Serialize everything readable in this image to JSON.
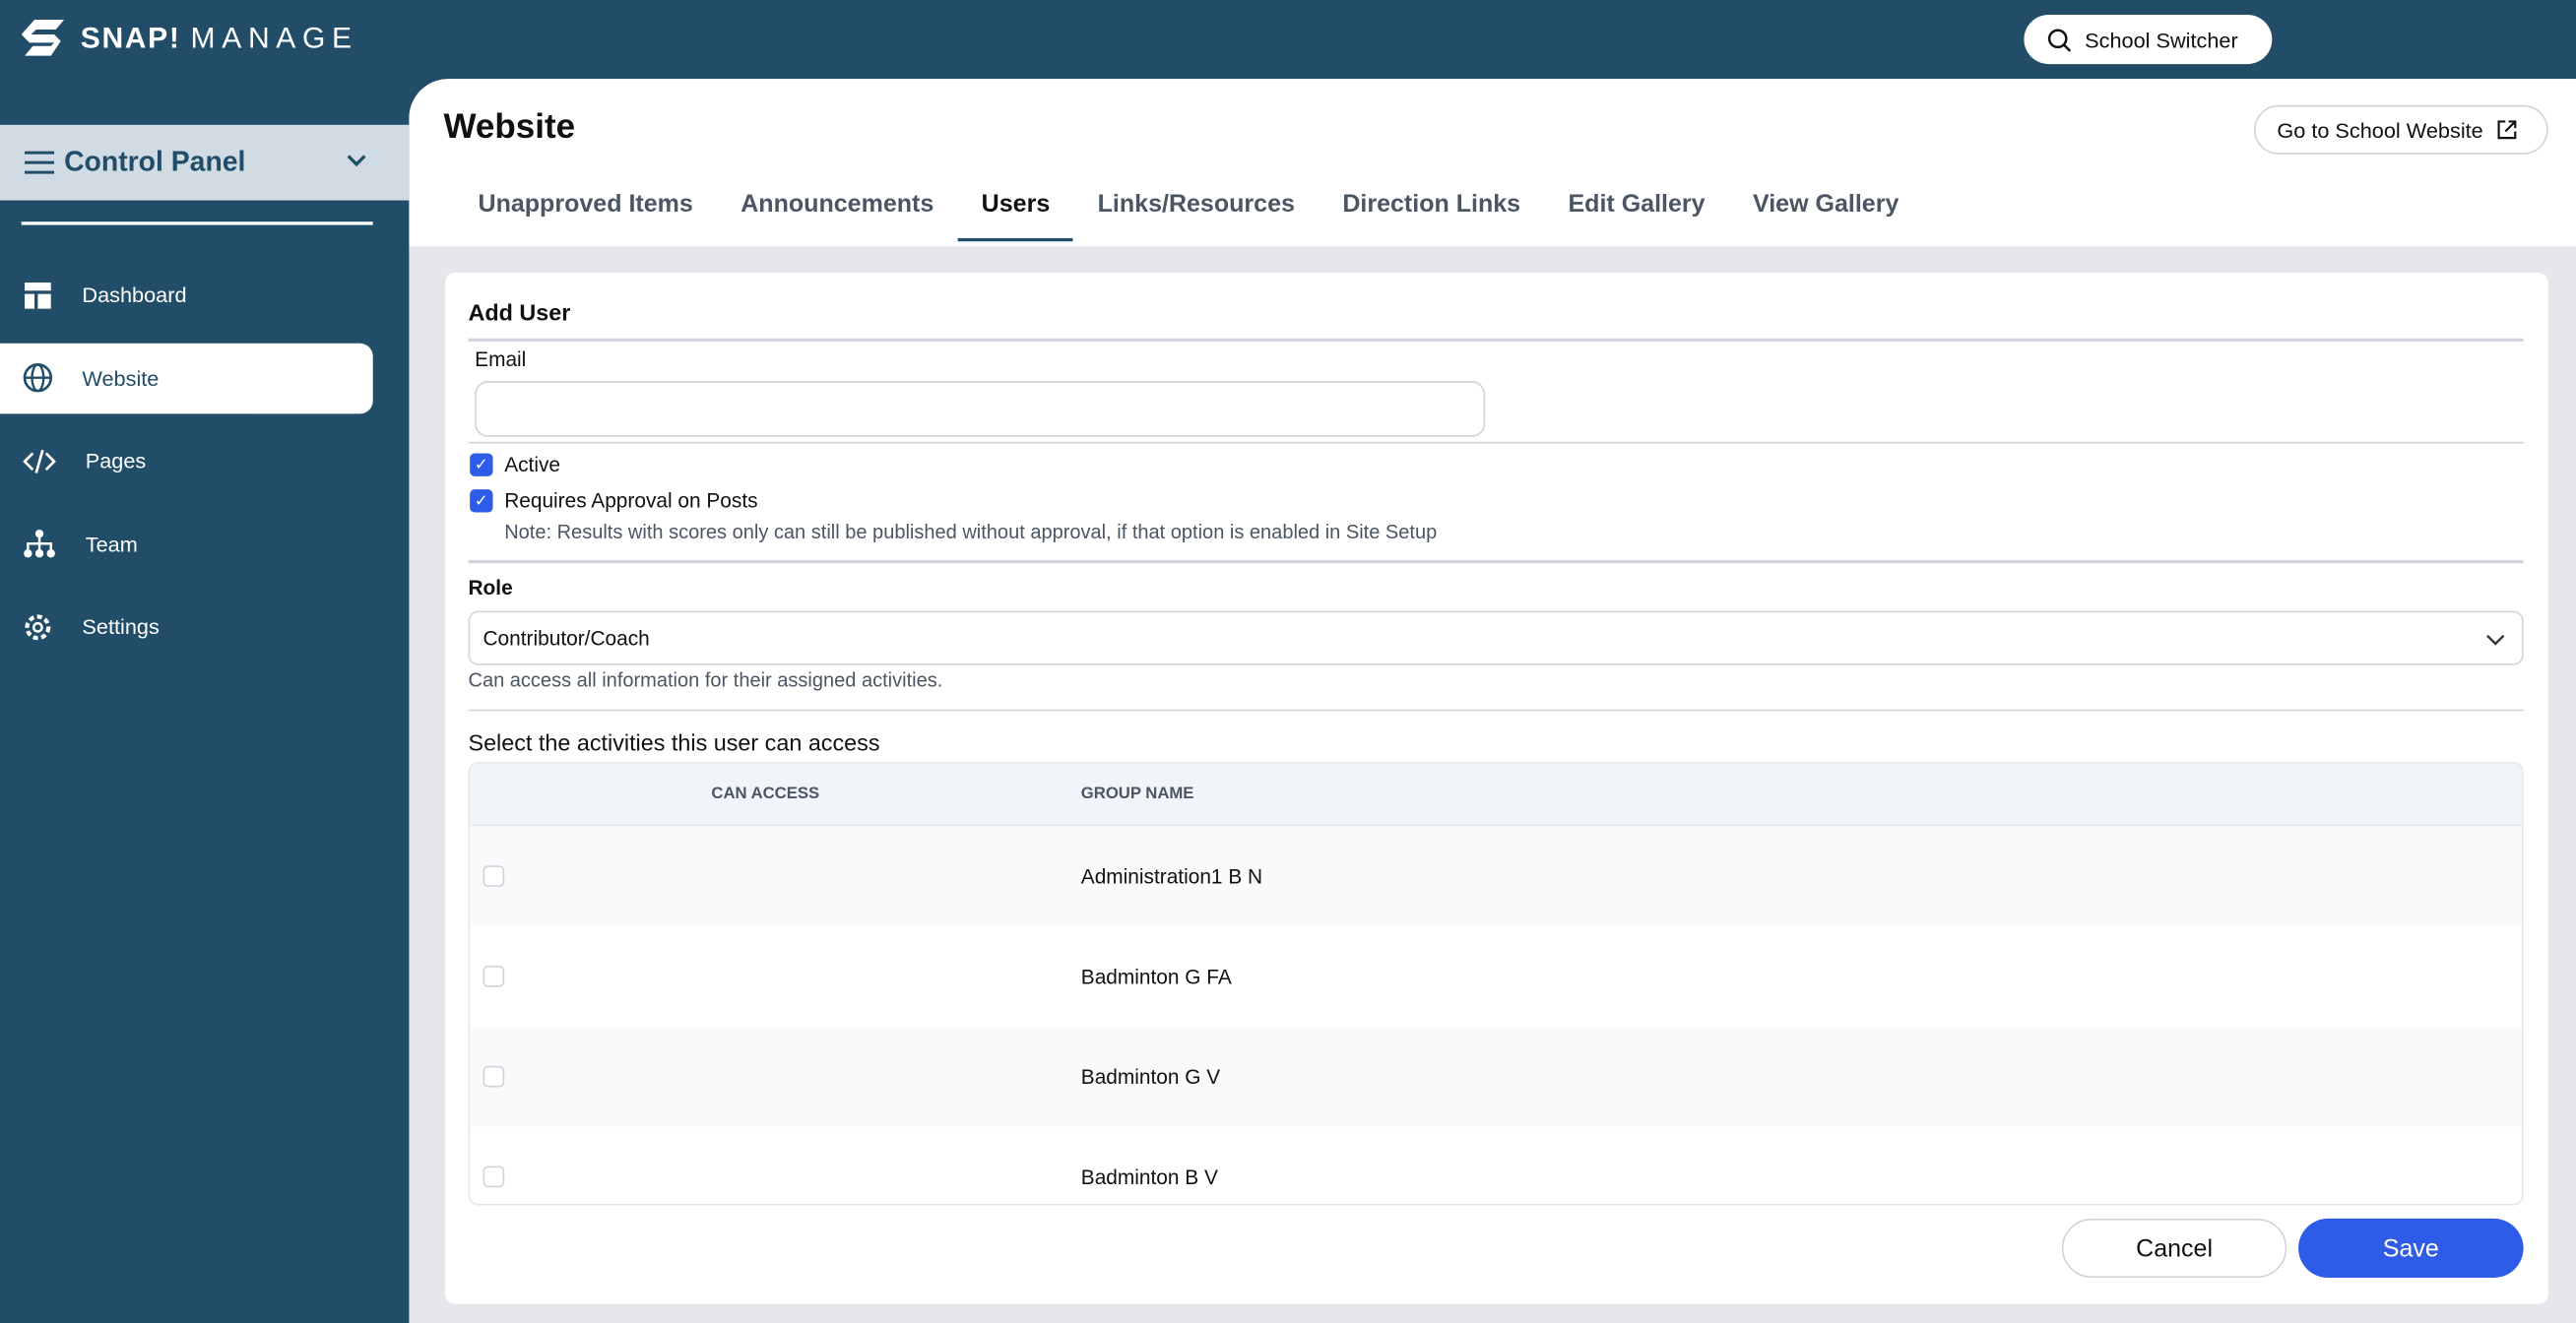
{
  "header": {
    "brand": "SNAP!",
    "brand_suffix": "MANAGE",
    "school_switcher": "School Switcher"
  },
  "sidebar": {
    "section": "Control Panel",
    "items": [
      {
        "label": "Dashboard",
        "icon": "dashboard-icon"
      },
      {
        "label": "Website",
        "icon": "globe-icon",
        "active": true
      },
      {
        "label": "Pages",
        "icon": "code-icon"
      },
      {
        "label": "Team",
        "icon": "org-chart-icon"
      },
      {
        "label": "Settings",
        "icon": "gear-icon"
      }
    ]
  },
  "page": {
    "title": "Website",
    "go_to_site": "Go to School Website",
    "tabs": [
      "Unapproved Items",
      "Announcements",
      "Users",
      "Links/Resources",
      "Direction Links",
      "Edit Gallery",
      "View Gallery"
    ],
    "active_tab": "Users"
  },
  "form": {
    "heading": "Add User",
    "email_label": "Email",
    "email_value": "",
    "active_label": "Active",
    "active_checked": true,
    "approval_label": "Requires Approval on Posts",
    "approval_checked": true,
    "approval_note": "Note: Results with scores only can still be published without approval, if that option is enabled in Site Setup",
    "role_label": "Role",
    "role_value": "Contributor/Coach",
    "role_help": "Can access all information for their assigned activities.",
    "activities_label": "Select the activities this user can access"
  },
  "table": {
    "columns": [
      "CAN ACCESS",
      "GROUP NAME"
    ],
    "rows": [
      {
        "name": "Administration1 B N",
        "checked": false
      },
      {
        "name": "Badminton G FA",
        "checked": false
      },
      {
        "name": "Badminton G V",
        "checked": false
      },
      {
        "name": "Badminton B V",
        "checked": false
      }
    ]
  },
  "actions": {
    "cancel": "Cancel",
    "save": "Save"
  },
  "colors": {
    "sidebar": "#214d68",
    "accent": "#2f5ce6"
  }
}
